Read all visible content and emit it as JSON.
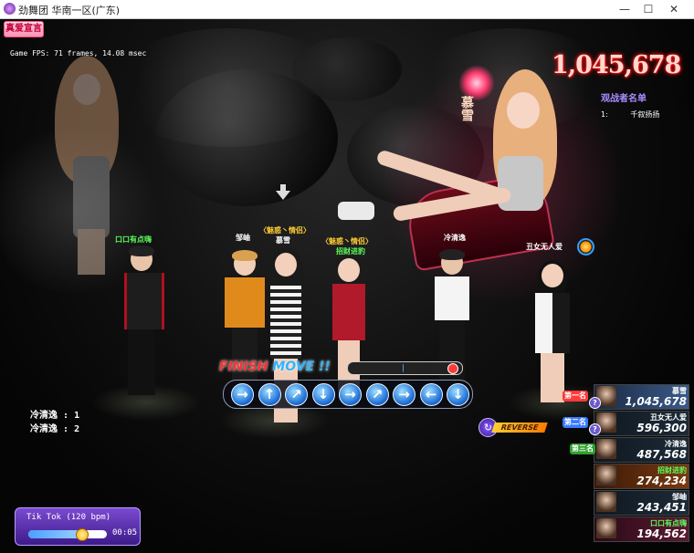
{
  "window": {
    "title": "劲舞团 华南一区(广东)",
    "minimize": "—",
    "maximize": "☐",
    "close": "✕"
  },
  "hud": {
    "love_button": "真爱宣言",
    "fps": "Game FPS: 71 frames, 14.08 msec",
    "score": "1,045,678",
    "spectators_title": "观战者名单",
    "spectators": [
      {
        "index": "1:",
        "name": "千叙扬扬"
      }
    ],
    "throne_label": "慕雪"
  },
  "players": [
    {
      "name": "口口有点嗨",
      "tag": "",
      "name_color": "#5cff5c"
    },
    {
      "name": "邹岫",
      "tag": "",
      "name_color": "#ffffff"
    },
    {
      "name": "慕雪",
      "tag": "〈魅惑丶情侣〉",
      "name_color": "#ffffff"
    },
    {
      "name": "招财进豹",
      "tag": "〈魅惑丶情侣〉",
      "name_color": "#5cff5c"
    },
    {
      "name": "冷清逸",
      "tag": "",
      "name_color": "#ffffff"
    },
    {
      "name": "丑女无人爱",
      "tag": "",
      "name_color": "#ffffff"
    }
  ],
  "dance": {
    "finish_text_1": "FINISH ",
    "finish_text_2": "MOVE !!",
    "power_level": 0.55,
    "arrows": [
      "→",
      "↑",
      "↗",
      "↓",
      "→",
      "↗",
      "→",
      "←",
      "↓"
    ],
    "arrow_icons": [
      "arrow-right-icon",
      "arrow-up-icon",
      "arrow-up-right-icon",
      "arrow-down-icon",
      "arrow-right-icon",
      "arrow-up-right-icon",
      "arrow-right-icon",
      "arrow-left-icon",
      "arrow-down-icon"
    ],
    "reverse_label": "REVERSE",
    "reverse_icon": "↻"
  },
  "chat": [
    {
      "name": "冷清逸",
      "value": ": 1"
    },
    {
      "name": "冷清逸",
      "value": ": 2"
    }
  ],
  "music": {
    "song": "Tik Tok (120 bpm)",
    "time": "00:05",
    "progress": 0.68
  },
  "ranking": [
    {
      "place": "第一名",
      "name": "慕雪",
      "score": "1,045,678",
      "badge_color": "#ff3a3a"
    },
    {
      "place": "第二名",
      "name": "丑女无人爱",
      "score": "596,300",
      "badge_color": "#3a7aff"
    },
    {
      "place": "第三名",
      "name": "冷清逸",
      "score": "487,568",
      "badge_color": "#2fa02f"
    },
    {
      "place": "",
      "name": "招财进豹",
      "score": "274,234",
      "badge_color": ""
    },
    {
      "place": "",
      "name": "邹岫",
      "score": "243,451",
      "badge_color": ""
    },
    {
      "place": "",
      "name": "口口有点嗨",
      "score": "194,562",
      "badge_color": ""
    }
  ]
}
